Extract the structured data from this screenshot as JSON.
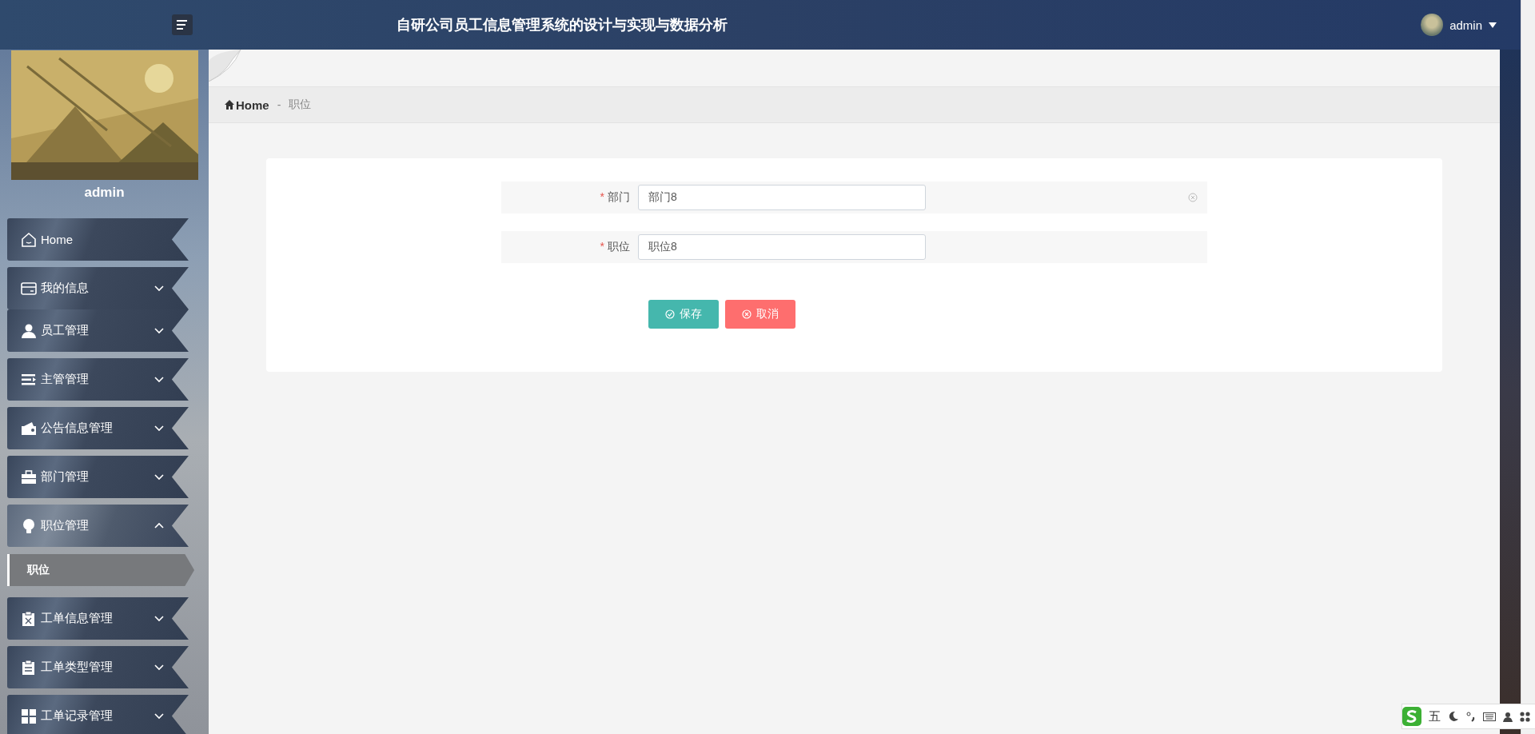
{
  "header": {
    "title": "自研公司员工信息管理系统的设计与实现与数据分析",
    "user": "admin"
  },
  "sidebar": {
    "profile": {
      "name": "admin"
    },
    "items": [
      {
        "label": "Home"
      },
      {
        "label": "我的信息",
        "expanded": false
      },
      {
        "label": "员工管理",
        "expanded": false
      },
      {
        "label": "主管管理",
        "expanded": false
      },
      {
        "label": "公告信息管理",
        "expanded": false
      },
      {
        "label": "部门管理",
        "expanded": false
      },
      {
        "label": "职位管理",
        "expanded": true,
        "children": [
          {
            "label": "职位",
            "selected": true
          }
        ]
      },
      {
        "label": "工单信息管理",
        "expanded": false
      },
      {
        "label": "工单类型管理",
        "expanded": false
      },
      {
        "label": "工单记录管理",
        "expanded": false
      }
    ]
  },
  "breadcrumb": {
    "separator": "-",
    "items": [
      {
        "label": "Home"
      },
      {
        "label": "职位"
      }
    ]
  },
  "form": {
    "fields": [
      {
        "label": "部门",
        "required_mark": "*",
        "value": "部门8",
        "clearable": true
      },
      {
        "label": "职位",
        "required_mark": "*",
        "value": "职位8",
        "clearable": false
      }
    ],
    "buttons": [
      {
        "label": "保存",
        "kind": "save"
      },
      {
        "label": "取消",
        "kind": "cancel"
      }
    ]
  },
  "ime_bar": {
    "mode": "五"
  }
}
